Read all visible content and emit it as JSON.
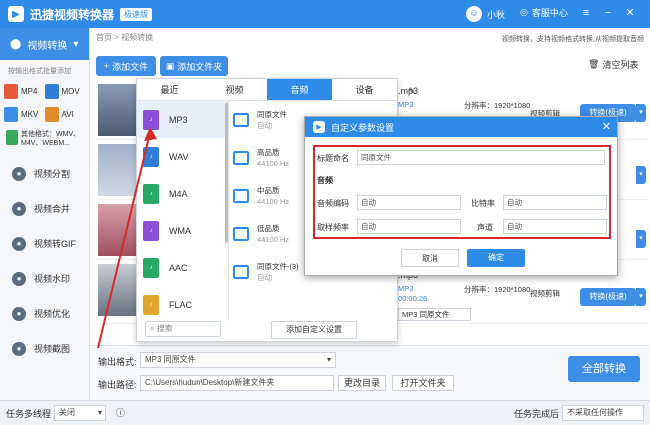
{
  "app": {
    "title": "迅捷视频转换器",
    "badge": "极速版",
    "user": "小秋",
    "service": "客服中心"
  },
  "sidebar": {
    "main": "视频转换",
    "hint": "按输出格式批量添加",
    "formats": [
      {
        "label": "MP4",
        "color": "#e55a3a"
      },
      {
        "label": "MOV",
        "color": "#2f7fd8"
      },
      {
        "label": "MKV",
        "color": "#3d8ee6"
      },
      {
        "label": "AVI",
        "color": "#e08a2a"
      }
    ],
    "other": "其他格式：WMV、M4V、WEBM...",
    "items": [
      {
        "label": "视频分割",
        "icon": "scissors-icon"
      },
      {
        "label": "视频合并",
        "icon": "merge-icon"
      },
      {
        "label": "视频转GIF",
        "icon": "gif-icon"
      },
      {
        "label": "视频水印",
        "icon": "watermark-icon"
      },
      {
        "label": "视频优化",
        "icon": "optimize-icon"
      },
      {
        "label": "视频截图",
        "icon": "screenshot-icon"
      }
    ]
  },
  "main": {
    "breadcrumb": "首页 > 视频转换",
    "note": "视频转换，支持视频格式转换,从视频提取音频",
    "add_file": "添加文件",
    "add_folder": "添加文件夹",
    "clear": "清空列表",
    "rows": [
      {
        "name": ".mp3",
        "resolution": "分辨率：1920*1080",
        "edit": "视频剪辑",
        "convert": "转换(极速)"
      },
      {
        "name": "",
        "resolution": "",
        "edit": "",
        "convert": ""
      },
      {
        "name": "",
        "resolution": "",
        "edit": "",
        "convert": ""
      },
      {
        "name": ".mp3",
        "resolution": "分辨率：1920*1080",
        "duration": "00:00:26",
        "edit": "视频剪辑",
        "convert": "转换(极速)",
        "format": "MP3  同原文件"
      }
    ]
  },
  "bottom": {
    "output_format_label": "输出格式:",
    "output_format_value": "MP3  同原文件",
    "output_path_label": "输出路径:",
    "output_path_value": "C:\\Users\\hudun\\Desktop\\新建文件夹",
    "change_dir": "更改目录",
    "open_folder": "打开文件夹",
    "convert_all": "全部转换"
  },
  "status": {
    "multi_thread": "任务多线程",
    "thread_value": "关闭",
    "done_label": "任务完成后",
    "done_value": "不采取任何操作"
  },
  "popup": {
    "tabs": [
      "最近",
      "视频",
      "音频",
      "设备"
    ],
    "formats": [
      {
        "label": "MP3",
        "color": "#8a4fd8"
      },
      {
        "label": "WAV",
        "color": "#2f7fd8"
      },
      {
        "label": "M4A",
        "color": "#2aa866"
      },
      {
        "label": "WMA",
        "color": "#8a4fd8"
      },
      {
        "label": "AAC",
        "color": "#2aa866"
      },
      {
        "label": "FLAC",
        "color": "#e0a52a"
      }
    ],
    "qualities": [
      {
        "title": "同原文件",
        "sub": "自动"
      },
      {
        "title": "高品质",
        "sub": "44100 Hz"
      },
      {
        "title": "中品质",
        "sub": "44100 Hz"
      },
      {
        "title": "低品质",
        "sub": "44100 Hz"
      },
      {
        "title": "同原文件-(3)",
        "sub": "自动"
      }
    ],
    "search": "搜索",
    "add_custom": "添加自定义设置"
  },
  "dialog": {
    "title": "自定义参数设置",
    "name_label": "标题命名",
    "name_value": "同原文件",
    "section": "音频",
    "codec_label": "音频编码",
    "codec_value": "自动",
    "bitrate_label": "比特率",
    "bitrate_value": "自动",
    "samplerate_label": "取样频率",
    "samplerate_value": "自动",
    "channel_label": "声道",
    "channel_value": "自动",
    "cancel": "取消",
    "ok": "确定"
  }
}
